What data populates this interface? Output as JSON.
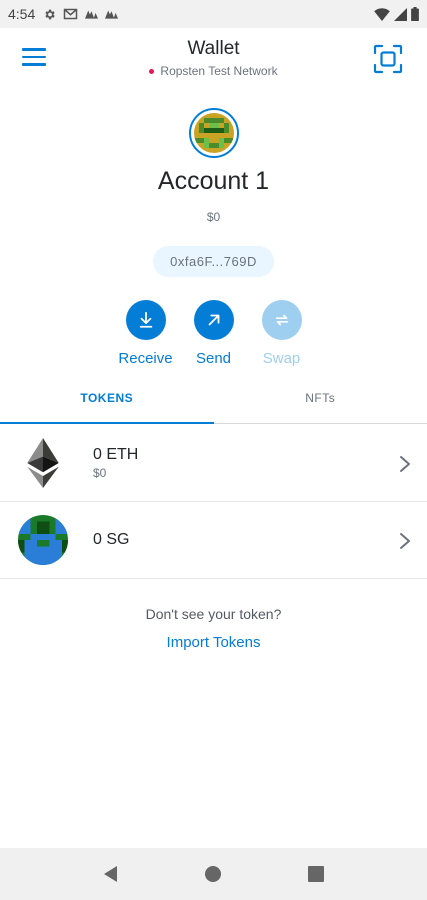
{
  "status_bar": {
    "time": "4:54",
    "icons": [
      "gear-icon",
      "gmail-icon",
      "app-notification-icon",
      "app-notification-icon",
      "wifi-icon",
      "signal-icon",
      "battery-icon"
    ]
  },
  "header": {
    "title": "Wallet",
    "network": "Ropsten Test Network",
    "network_dot_color": "#e91550"
  },
  "account": {
    "name": "Account 1",
    "balance": "$0",
    "address": "0xfa6F...769D"
  },
  "actions": [
    {
      "label": "Receive",
      "icon": "download-icon",
      "enabled": true
    },
    {
      "label": "Send",
      "icon": "arrow-up-right-icon",
      "enabled": true
    },
    {
      "label": "Swap",
      "icon": "swap-icon",
      "enabled": false
    }
  ],
  "tabs": [
    {
      "label": "TOKENS",
      "active": true
    },
    {
      "label": "NFTs",
      "active": false
    }
  ],
  "tokens": [
    {
      "amount": "0 ETH",
      "fiat": "$0",
      "icon": "ethereum-icon"
    },
    {
      "amount": "0 SG",
      "fiat": "",
      "icon": "token-identicon"
    }
  ],
  "import": {
    "prompt": "Don't see your token?",
    "link": "Import Tokens"
  },
  "colors": {
    "accent": "#037dd6",
    "accent_disabled": "#9fcff0",
    "text": "#24272a",
    "muted": "#6a737d"
  }
}
